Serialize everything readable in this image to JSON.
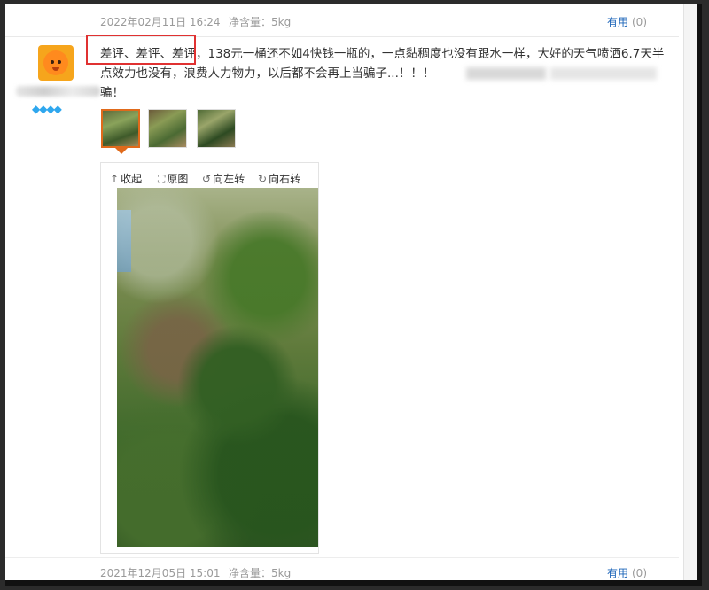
{
  "prev_review": {
    "date": "2022年02月11日 16:24",
    "spec": "净含量：5kg",
    "useful_label": "有用",
    "useful_count": "(0)"
  },
  "review": {
    "level_icon": "◆◆◆◆",
    "text": "差评、差评、差评，138元一桶还不如4快钱一瓶的，一点黏稠度也没有跟水一样，大好的天气喷洒6.7天半点效力也没有，浪费人力物力，以后都不会再上当骗子...！！！",
    "text_end": "骗！",
    "thumbnails": [
      "photo-1",
      "photo-2",
      "photo-3"
    ],
    "toolbar": {
      "collapse_icon": "↑",
      "collapse": "收起",
      "original_icon": "⛶",
      "original": "原图",
      "rotate_left_icon": "↺",
      "rotate_left": "向左转",
      "rotate_right_icon": "↻",
      "rotate_right": "向右转"
    }
  },
  "next_review": {
    "date": "2021年12月05日 15:01",
    "spec": "净含量：5kg",
    "useful_label": "有用",
    "useful_count": "(0)"
  },
  "colors": {
    "link": "#1a63b8",
    "accent_orange": "#e06a1b",
    "highlight_red": "#e03131",
    "level_blue": "#2fa7ee"
  }
}
